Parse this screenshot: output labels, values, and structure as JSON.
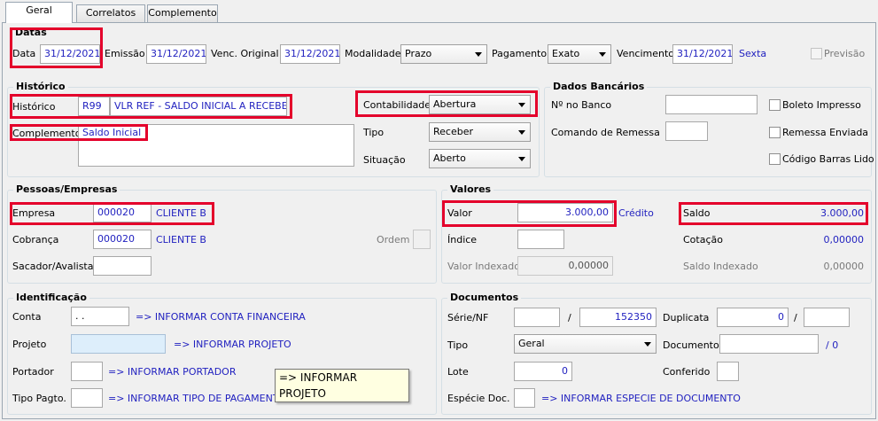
{
  "tabs": [
    "Geral",
    "Correlatos",
    "Complemento"
  ],
  "datas": {
    "title": "Datas",
    "data_label": "Data",
    "data_value": "31/12/2021",
    "emissao_label": "Emissão",
    "emissao_value": "31/12/2021",
    "venc_label": "Venc. Original",
    "venc_value": "31/12/2021",
    "modalidade_label": "Modalidade",
    "modalidade_value": "Prazo",
    "pagamento_label": "Pagamento",
    "pagamento_value": "Exato",
    "vencimento_label": "Vencimento",
    "vencimento_value": "31/12/2021",
    "weekday": "Sexta",
    "previsao_label": "Previsão"
  },
  "historico": {
    "title": "Histórico",
    "historico_label": "Histórico",
    "historico_code": "R99",
    "historico_desc": "VLR REF - SALDO INICIAL A RECEBER",
    "complemento_label": "Complemento",
    "complemento_value": "Saldo Inicial",
    "contabilidade_label": "Contabilidade",
    "contabilidade_value": "Abertura",
    "tipo_label": "Tipo",
    "tipo_value": "Receber",
    "situacao_label": "Situação",
    "situacao_value": "Aberto"
  },
  "dados_bancarios": {
    "title": "Dados Bancários",
    "no_banco_label": "Nº no Banco",
    "comando_label": "Comando de Remessa",
    "boleto_label": "Boleto Impresso",
    "remessa_label": "Remessa Enviada",
    "codigo_label": "Código Barras Lido"
  },
  "pessoas": {
    "title": "Pessoas/Empresas",
    "empresa_label": "Empresa",
    "empresa_code": "000020",
    "empresa_name": "CLIENTE B",
    "cobranca_label": "Cobrança",
    "cobranca_code": "000020",
    "cobranca_name": "CLIENTE B",
    "ordem_label": "Ordem",
    "sacador_label": "Sacador/Avalista"
  },
  "valores": {
    "title": "Valores",
    "valor_label": "Valor",
    "valor_value": "3.000,00",
    "valor_tipo": "Crédito",
    "saldo_label": "Saldo",
    "saldo_value": "3.000,00",
    "indice_label": "Índice",
    "cotacao_label": "Cotação",
    "cotacao_value": "0,00000",
    "valor_indexado_label": "Valor Indexado",
    "valor_indexado_value": "0,00000",
    "saldo_indexado_label": "Saldo Indexado",
    "saldo_indexado_value": "0,00000"
  },
  "identificacao": {
    "title": "Identificação",
    "conta_label": "Conta",
    "conta_value": ". .",
    "conta_hint": "=> INFORMAR CONTA FINANCEIRA",
    "projeto_label": "Projeto",
    "projeto_hint": "=> INFORMAR PROJETO",
    "portador_label": "Portador",
    "portador_hint": "=> INFORMAR PORTADOR",
    "tipo_pagto_label": "Tipo Pagto.",
    "tipo_pagto_hint": "=> INFORMAR TIPO DE PAGAMENTO"
  },
  "documentos": {
    "title": "Documentos",
    "serie_label": "Série/NF",
    "slash": "/",
    "nf_value": "152350",
    "duplicata_label": "Duplicata",
    "duplicata_value": "0",
    "tipo_label": "Tipo",
    "tipo_value": "Geral",
    "documento_label": "Documento",
    "documento_suffix": "/  0",
    "lote_label": "Lote",
    "lote_value": "0",
    "conferido_label": "Conferido",
    "especie_label": "Espécie Doc.",
    "especie_hint": "=> INFORMAR ESPECIE DE DOCUMENTO"
  },
  "tooltip": "=> INFORMAR PROJETO",
  "colors": {
    "highlight": "#e4002b",
    "value_text": "#1f1fbf"
  }
}
